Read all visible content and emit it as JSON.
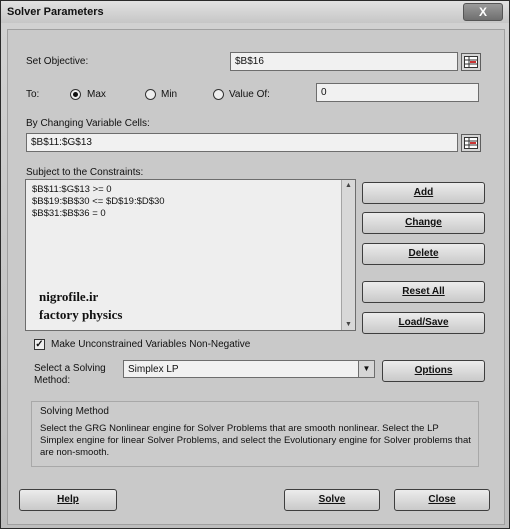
{
  "window": {
    "title": "Solver Parameters",
    "close_glyph": "X"
  },
  "objective": {
    "label": "Set Objective:",
    "value": "$B$16"
  },
  "to": {
    "label": "To:",
    "options": [
      {
        "label": "Max",
        "selected": true
      },
      {
        "label": "Min",
        "selected": false
      },
      {
        "label": "Value Of:",
        "selected": false
      }
    ],
    "value_of": "0"
  },
  "changing": {
    "label": "By Changing Variable Cells:",
    "value": "$B$11:$G$13"
  },
  "constraints": {
    "label": "Subject to the Constraints:",
    "items": [
      "$B$11:$G$13 >= 0",
      "$B$19:$B$30 <= $D$19:$D$30",
      "$B$31:$B$36 = 0"
    ]
  },
  "watermark": {
    "line1": "nigrofile.ir",
    "line2": "factory physics"
  },
  "buttons": {
    "add": "Add",
    "change": "Change",
    "delete": "Delete",
    "reset_all": "Reset All",
    "load_save": "Load/Save",
    "options": "Options",
    "help": "Help",
    "solve": "Solve",
    "close": "Close"
  },
  "nonneg": {
    "label": "Make Unconstrained Variables Non-Negative",
    "checked": true
  },
  "method": {
    "label_line1": "Select a Solving",
    "label_line2": "Method:",
    "value": "Simplex LP"
  },
  "method_info": {
    "title": "Solving Method",
    "description": "Select the GRG Nonlinear engine for Solver Problems that are smooth nonlinear. Select the LP Simplex engine for linear Solver Problems, and select the Evolutionary engine for Solver problems that are non-smooth."
  },
  "icons": {
    "range": "range-select-icon",
    "dropdown": "chevron-down-icon",
    "scroll_up": "scroll-up-icon",
    "scroll_down": "scroll-down-icon"
  }
}
